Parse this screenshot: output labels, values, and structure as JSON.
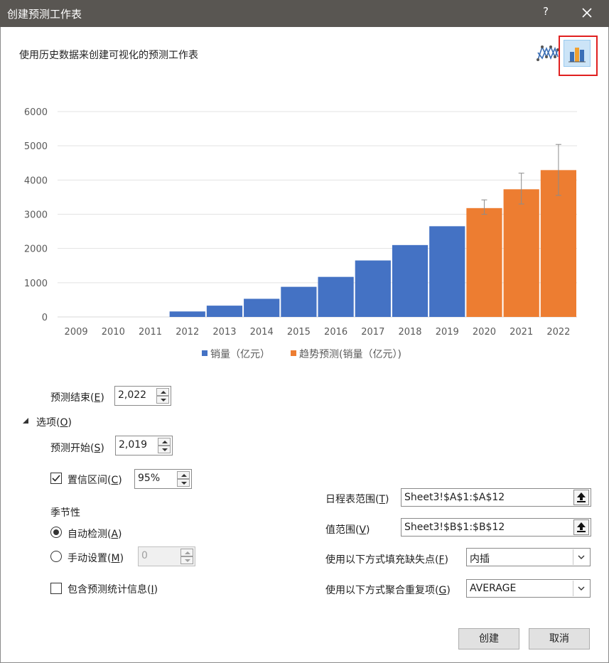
{
  "window": {
    "title": "创建预测工作表",
    "help_label": "?"
  },
  "subtitle": "使用历史数据来创建可视化的预测工作表",
  "view_buttons": {
    "line_icon": "line-chart-icon",
    "column_icon": "column-chart-icon",
    "selected": "column"
  },
  "chart_data": {
    "type": "bar",
    "categories": [
      "2009",
      "2010",
      "2011",
      "2012",
      "2013",
      "2014",
      "2015",
      "2016",
      "2017",
      "2018",
      "2019",
      "2020",
      "2021",
      "2022"
    ],
    "series": [
      {
        "name": "销量（亿元）",
        "color": "#4472c4",
        "values": [
          0,
          0,
          0,
          160,
          330,
          530,
          880,
          1170,
          1650,
          2100,
          2650,
          null,
          null,
          null
        ]
      },
      {
        "name": "趋势预测(销量（亿元）)",
        "color": "#ed7d31",
        "values": [
          null,
          null,
          null,
          null,
          null,
          null,
          null,
          null,
          null,
          null,
          null,
          3180,
          3730,
          4290
        ]
      }
    ],
    "error_bars": {
      "2020": [
        3000,
        3420
      ],
      "2021": [
        3300,
        4200
      ],
      "2022": [
        3550,
        5040
      ]
    },
    "ylim": [
      0,
      6000
    ],
    "yticks": [
      "0",
      "1000",
      "2000",
      "3000",
      "4000",
      "5000",
      "6000"
    ],
    "grid": true,
    "legend_position": "bottom"
  },
  "forecast_end": {
    "label_main": "预测结束(",
    "label_key": "E",
    "label_close": ")",
    "value": "2,022"
  },
  "options_toggle": {
    "label_main": "选项(",
    "label_key": "O",
    "label_close": ")"
  },
  "forecast_start": {
    "label_main": "预测开始(",
    "label_key": "S",
    "label_close": ")",
    "value": "2,019"
  },
  "confidence": {
    "label_main": "置信区间(",
    "label_key": "C",
    "label_close": ")",
    "checked": true,
    "value": "95%"
  },
  "seasonality": {
    "heading": "季节性",
    "auto": {
      "label_main": "自动检测(",
      "label_key": "A",
      "label_close": ")",
      "selected": true
    },
    "manual": {
      "label_main": "手动设置(",
      "label_key": "M",
      "label_close": ")",
      "selected": false,
      "value": "0"
    }
  },
  "include_stats": {
    "label_main": "包含预测统计信息(",
    "label_key": "I",
    "label_close": ")",
    "checked": false
  },
  "timeline_range": {
    "label_main": "日程表范围(",
    "label_key": "T",
    "label_close": ")",
    "value": "Sheet3!$A$1:$A$12"
  },
  "values_range": {
    "label_main": "值范围(",
    "label_key": "V",
    "label_close": ")",
    "value": "Sheet3!$B$1:$B$12"
  },
  "fill_missing": {
    "label_main": "使用以下方式填充缺失点(",
    "label_key": "F",
    "label_close": ")",
    "value": "内插"
  },
  "aggregate_dup": {
    "label_main": "使用以下方式聚合重复项(",
    "label_key": "G",
    "label_close": ")",
    "value": "AVERAGE"
  },
  "buttons": {
    "create": "创建",
    "cancel": "取消"
  }
}
